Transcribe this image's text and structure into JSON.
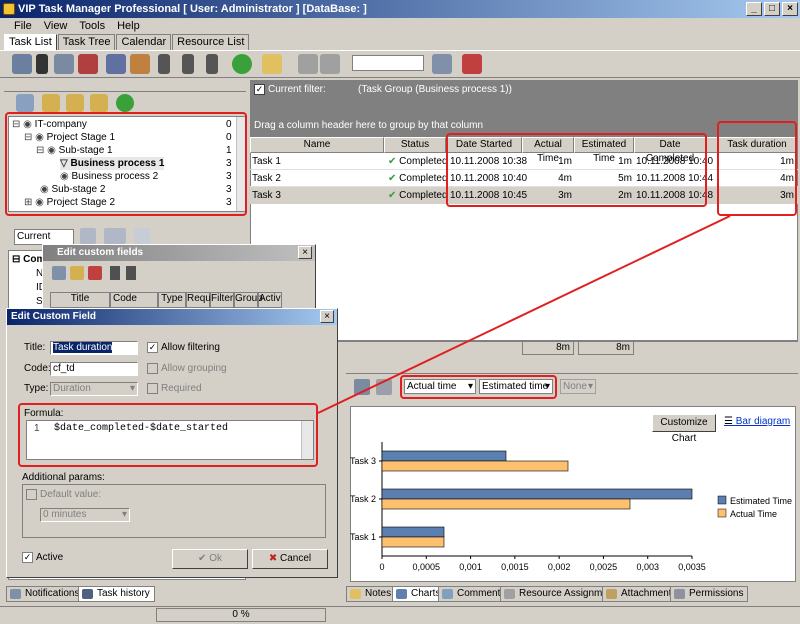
{
  "window": {
    "title": "VIP Task Manager Professional [ User: Administrator ] [DataBase:         ]"
  },
  "menu": [
    "File",
    "View",
    "Tools",
    "Help"
  ],
  "main_tabs": [
    "Task List",
    "Task Tree",
    "Calendar",
    "Resource List"
  ],
  "tree": {
    "items": [
      {
        "label": "IT-company",
        "count": "0"
      },
      {
        "label": "Project Stage 1",
        "count": "0"
      },
      {
        "label": "Sub-stage 1",
        "count": "1"
      },
      {
        "label": "Business process 1",
        "count": "3"
      },
      {
        "label": "Business process 2",
        "count": "3"
      },
      {
        "label": "Sub-stage 2",
        "count": "3"
      },
      {
        "label": "Project Stage 2",
        "count": "3"
      }
    ]
  },
  "filter_combo": "Current",
  "current_filter": {
    "label": "Current filter:",
    "value": "(Task Group  (Business process 1))"
  },
  "group_hint": "Drag a column header here to group by that column",
  "grid": {
    "headers": [
      "Name",
      "Status",
      "Date Started",
      "Actual Time",
      "Estimated Time",
      "Date Completed",
      "Task duration"
    ],
    "rows": [
      [
        "Task 1",
        "Completed",
        "10.11.2008 10:38",
        "1m",
        "1m",
        "10.11.2008 10:40",
        "1m"
      ],
      [
        "Task 2",
        "Completed",
        "10.11.2008 10:40",
        "4m",
        "5m",
        "10.11.2008 10:44",
        "4m"
      ],
      [
        "Task 3",
        "Completed",
        "10.11.2008 10:45",
        "3m",
        "2m",
        "10.11.2008 10:48",
        "3m"
      ]
    ],
    "footer": [
      "8m",
      "8m"
    ]
  },
  "custom_fields_dialog": {
    "title": "Edit custom fields",
    "side_labels": [
      "Com",
      "N",
      "ID",
      "S"
    ],
    "columns": [
      "Title",
      "Code",
      "Type",
      "Requ",
      "Filteri",
      "Group",
      "Activ"
    ]
  },
  "edit_field_dialog": {
    "title": "Edit Custom Field",
    "title_label": "Title:",
    "title_value": "Task duration",
    "allow_filtering": "Allow filtering",
    "code_label": "Code:",
    "code_value": "cf_td",
    "allow_grouping": "Allow grouping",
    "type_label": "Type:",
    "type_value": "Duration",
    "required": "Required",
    "formula_label": "Formula:",
    "formula_line": "1",
    "formula_text": "$date_completed-$date_started",
    "additional": "Additional params:",
    "default_value": "Default value:",
    "default_combo": "0 minutes",
    "active": "Active",
    "ok": "Ok",
    "cancel": "Cancel"
  },
  "chart_toolbar": {
    "combo1": "Actual time",
    "combo2": "Estimated time",
    "combo3": "None",
    "customize": "Customize Chart",
    "bar_diagram": "Bar diagram"
  },
  "chart_data": {
    "type": "bar",
    "orientation": "horizontal",
    "categories": [
      "Task 1",
      "Task 2",
      "Task 3"
    ],
    "series": [
      {
        "name": "Estimated Time",
        "values": [
          0.0007,
          0.0035,
          0.0014
        ],
        "color": "#5b7fb0"
      },
      {
        "name": "Actual Time",
        "values": [
          0.0007,
          0.0028,
          0.0021
        ],
        "color": "#fcc06e"
      }
    ],
    "xlim": [
      0,
      0.0035
    ],
    "xticks": [
      "0",
      "0,0005",
      "0,001",
      "0,0015",
      "0,002",
      "0,0025",
      "0,003",
      "0,0035"
    ],
    "legend": "right"
  },
  "bottom_left_tabs": [
    "Notifications",
    "Task history"
  ],
  "bottom_right_tabs": [
    "Notes",
    "Charts",
    "Comments",
    "Resource Assignment",
    "Attachments",
    "Permissions"
  ],
  "status": {
    "progress": "0 %"
  }
}
